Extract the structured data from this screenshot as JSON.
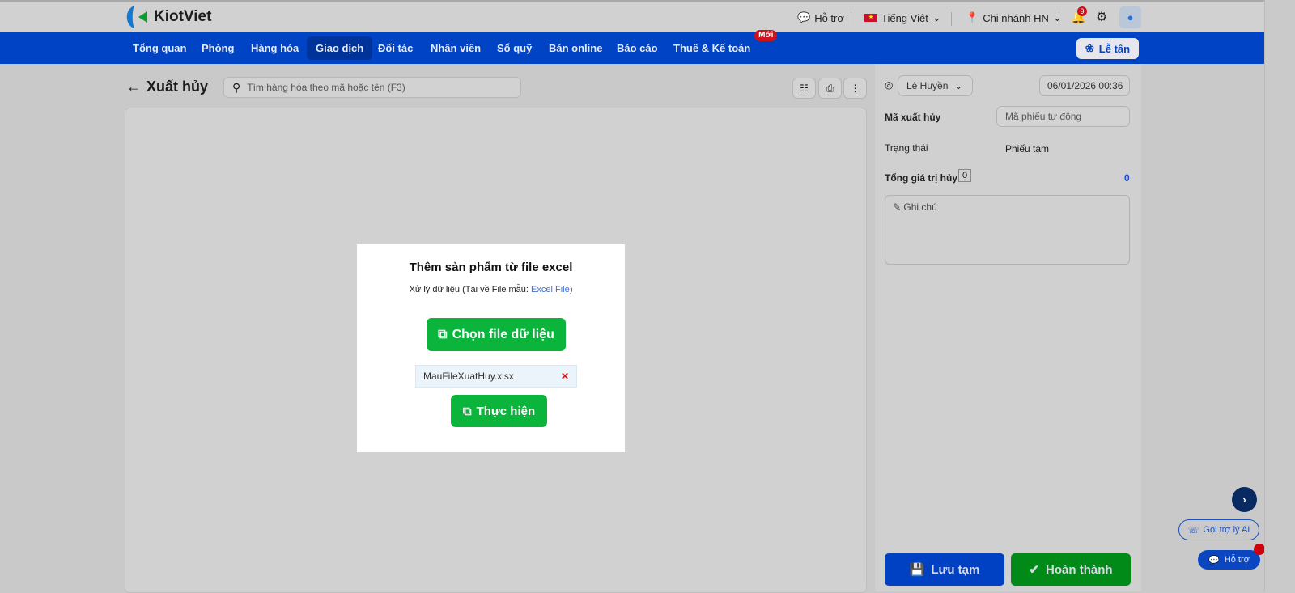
{
  "header": {
    "logo_text": "KiotViet",
    "support": "Hỗ trợ",
    "language": "Tiếng Việt",
    "branch": "Chi nhánh HN",
    "notification_count": "9"
  },
  "nav": {
    "items": [
      "Tổng quan",
      "Phòng",
      "Hàng hóa",
      "Giao dịch",
      "Đối tác",
      "Nhân viên",
      "Sổ quỹ",
      "Bán online",
      "Báo cáo",
      "Thuế & Kế toán"
    ],
    "active": "Giao dịch",
    "new_badge": "Mới",
    "reception_button": "Lễ tân"
  },
  "page": {
    "title": "Xuất hủy",
    "search_placeholder": "Tìm hàng hóa theo mã hoặc tên (F3)"
  },
  "side": {
    "user": "Lê Huyền",
    "datetime": "06/01/2026 00:36",
    "code_label": "Mã xuất hủy",
    "code_placeholder": "Mã phiếu tự động",
    "status_label": "Trạng thái",
    "status_value": "Phiếu tạm",
    "total_label": "Tổng giá trị hủy",
    "total_count": "0",
    "total_value": "0",
    "note_placeholder": "Ghi chú",
    "save_draft": "Lưu tạm",
    "complete": "Hoàn thành"
  },
  "modal": {
    "title": "Thêm sản phẩm từ file excel",
    "subtitle_prefix": "Xử lý dữ liệu (Tải về File mẫu: ",
    "subtitle_link": "Excel File",
    "subtitle_suffix": ")",
    "choose_file": "Chọn file dữ liệu",
    "file_name": "MauFileXuatHuy.xlsx",
    "execute": "Thực hiện"
  },
  "floating": {
    "ai_call": "Gọi trợ lý AI",
    "support": "Hỗ trợ"
  },
  "colors": {
    "brand_blue": "#0043c4",
    "green": "#0bb53c",
    "complete_green": "#028a18"
  }
}
